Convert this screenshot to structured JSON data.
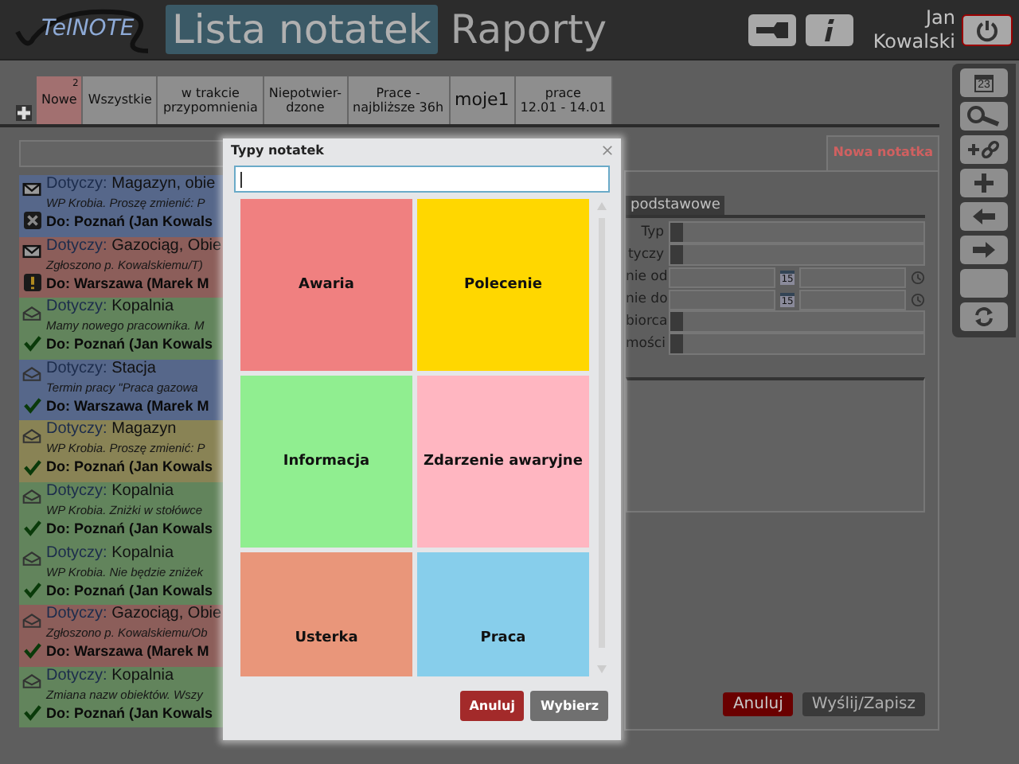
{
  "header": {
    "logo": "TelNOTE",
    "nav": [
      {
        "label": "Lista notatek",
        "selected": true
      },
      {
        "label": "Raporty",
        "selected": false
      }
    ],
    "user": [
      "Jan",
      "Kowalski"
    ]
  },
  "tabs": [
    {
      "label": "Nowe",
      "badge": "2",
      "selected": true
    },
    {
      "label": "Wszystkie",
      "selected": false
    },
    {
      "label": "w trakcie\nprzypomnienia",
      "selected": false
    },
    {
      "label": "Niepotwier-\ndzone",
      "selected": false
    },
    {
      "label": "Prace -\nnajbliższe 36h",
      "selected": false
    },
    {
      "label": "moje1",
      "selected": false
    },
    {
      "label": "prace\n12.01 - 14.01",
      "selected": false
    }
  ],
  "notes": [
    {
      "read": false,
      "kind": "rejected",
      "color": "#56678a",
      "label": "Dotyczy:",
      "subject": "Magazyn, obie",
      "text": "WP Krobia.  Proszę zmienić: P",
      "recipient": "Do: Poznań (Jan Kowals"
    },
    {
      "read": false,
      "kind": "warning",
      "color": "#8c5e5a",
      "label": "Dotyczy:",
      "subject": "Gazociąg, Obie",
      "text": "Zgłoszono p. Kowalskiemu/T)",
      "recipient": "Do: Warszawa (Marek M"
    },
    {
      "read": true,
      "kind": "done",
      "color": "#62845c",
      "label": "Dotyczy:",
      "subject": "Kopalnia",
      "text": "Mamy nowego pracownika. M",
      "recipient": "Do: Poznań (Jan Kowals"
    },
    {
      "read": true,
      "kind": "done",
      "color": "#56678a",
      "label": "Dotyczy:",
      "subject": "Stacja",
      "text": "Termin pracy \"Praca gazowa",
      "recipient": "Do: Warszawa (Marek M"
    },
    {
      "read": true,
      "kind": "done",
      "color": "#898355",
      "label": "Dotyczy:",
      "subject": "Magazyn",
      "text": "WP Krobia.  Proszę zmienić: P",
      "recipient": "Do: Poznań (Jan Kowals"
    },
    {
      "read": true,
      "kind": "done",
      "color": "#62845c",
      "label": "Dotyczy:",
      "subject": "Kopalnia",
      "text": "WP Krobia.  Zniżki w stołówce",
      "recipient": "Do: Poznań (Jan Kowals"
    },
    {
      "read": true,
      "kind": "done",
      "color": "#62845c",
      "label": "Dotyczy:",
      "subject": "Kopalnia",
      "text": "WP Krobia.  Nie będzie zniżek",
      "recipient": "Do: Poznań (Jan Kowals"
    },
    {
      "read": true,
      "kind": "done",
      "color": "#8c5e5a",
      "label": "Dotyczy:",
      "subject": "Gazociąg, Obie",
      "text": "Zgłoszono p. Kowalskiemu/Ob",
      "recipient": "Do: Warszawa (Marek M"
    },
    {
      "read": true,
      "kind": "done",
      "color": "#62845c",
      "label": "Dotyczy:",
      "subject": "Kopalnia",
      "text": "Zmiana nazw obiektów. Wszy",
      "recipient": "Do: Poznań (Jan Kowals"
    }
  ],
  "form": {
    "tab": "Nowa notatka",
    "section": "podstawowe",
    "fields": [
      {
        "kind": "select",
        "label": "Typ"
      },
      {
        "kind": "select",
        "label": "tyczy"
      },
      {
        "kind": "datetime",
        "label": "nie od",
        "calendar": "15"
      },
      {
        "kind": "datetime",
        "label": "nie do",
        "calendar": "15"
      },
      {
        "kind": "select",
        "label": "biorca"
      },
      {
        "kind": "select",
        "label": "mości"
      }
    ],
    "buttons": [
      {
        "kind": "danger",
        "label": "Anuluj"
      },
      {
        "kind": "neutral",
        "label": "Wyślij/Zapisz"
      }
    ]
  },
  "toolbar": [
    {
      "kind": "calendar",
      "label": "23"
    },
    {
      "kind": "search"
    },
    {
      "kind": "add-link"
    },
    {
      "kind": "plus"
    },
    {
      "kind": "arrow-left"
    },
    {
      "kind": "arrow-right"
    },
    {
      "kind": "blank"
    },
    {
      "kind": "refresh"
    }
  ],
  "dialog": {
    "title": "Typy notatek",
    "types": [
      {
        "label": "Awaria",
        "color": "#f08080"
      },
      {
        "label": "Polecenie",
        "color": "#ffd700"
      },
      {
        "label": "Informacja",
        "color": "#90ee90"
      },
      {
        "label": "Zdarzenie awaryjne",
        "color": "#ffb6c1"
      },
      {
        "label": "Usterka",
        "color": "#e9967a"
      },
      {
        "label": "Praca",
        "color": "#87ceeb"
      }
    ],
    "buttons": [
      {
        "kind": "danger",
        "label": "Anuluj"
      },
      {
        "kind": "neutral",
        "label": "Wybierz"
      }
    ]
  }
}
